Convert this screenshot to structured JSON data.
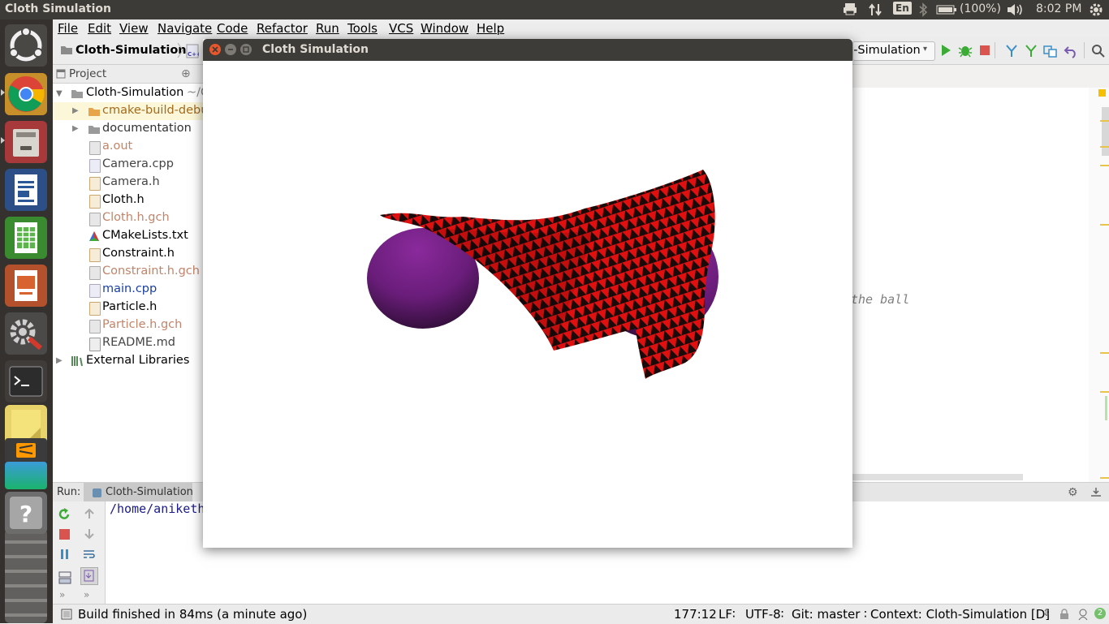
{
  "topbar": {
    "window_title": "Cloth Simulation",
    "keyboard": "En",
    "battery": "(100%)",
    "time": "8:02 PM"
  },
  "launcher": {
    "items": [
      "ubuntu-dash",
      "chrome",
      "files",
      "writer",
      "calc",
      "impress",
      "settings",
      "terminal",
      "notes",
      "sublime",
      "stacked-app",
      "help",
      "workspaces"
    ]
  },
  "ide": {
    "menu": [
      "File",
      "Edit",
      "View",
      "Navigate",
      "Code",
      "Refactor",
      "Run",
      "Tools",
      "VCS",
      "Window",
      "Help"
    ],
    "breadcrumb_project": "Cloth-Simulation",
    "run_config": "h-Simulation",
    "project_panel_label": "Project",
    "tree": [
      {
        "label": "Cloth-Simulation",
        "suffix": "~/C",
        "type": "root"
      },
      {
        "label": "cmake-build-debug",
        "type": "folder-excluded"
      },
      {
        "label": "documentation",
        "type": "folder"
      },
      {
        "label": "a.out",
        "type": "file-ignored"
      },
      {
        "label": "Camera.cpp",
        "type": "cpp"
      },
      {
        "label": "Camera.h",
        "type": "h"
      },
      {
        "label": "Cloth.h",
        "type": "h-modified"
      },
      {
        "label": "Cloth.h.gch",
        "type": "file-ignored"
      },
      {
        "label": "CMakeLists.txt",
        "type": "cmake"
      },
      {
        "label": "Constraint.h",
        "type": "h-modified"
      },
      {
        "label": "Constraint.h.gch",
        "type": "file-ignored"
      },
      {
        "label": "main.cpp",
        "type": "cpp-changed"
      },
      {
        "label": "Particle.h",
        "type": "h-modified"
      },
      {
        "label": "Particle.h.gch",
        "type": "file-ignored"
      },
      {
        "label": "README.md",
        "type": "md"
      },
      {
        "label": "External Libraries",
        "type": "libs"
      }
    ],
    "code_fragment": "the ball",
    "run_label": "Run:",
    "run_tab": "Cloth-Simulation",
    "console_text": "/home/aniketh",
    "status": {
      "message": "Build finished in 84ms (a minute ago)",
      "position": "177:12",
      "line_sep": "LF∶",
      "encoding": "UTF-8∶",
      "git": "Git: master ∶",
      "context": "Context: Cloth-Simulation [D]",
      "notifications": "2"
    }
  },
  "window": {
    "title": "Cloth Simulation"
  },
  "colors": {
    "cloth_red": "#e01010",
    "cloth_dark": "#1a0a0a",
    "sphere": "#7a1f8a",
    "ignored_file": "#c0846a",
    "changed_file": "#1a3fa0"
  }
}
